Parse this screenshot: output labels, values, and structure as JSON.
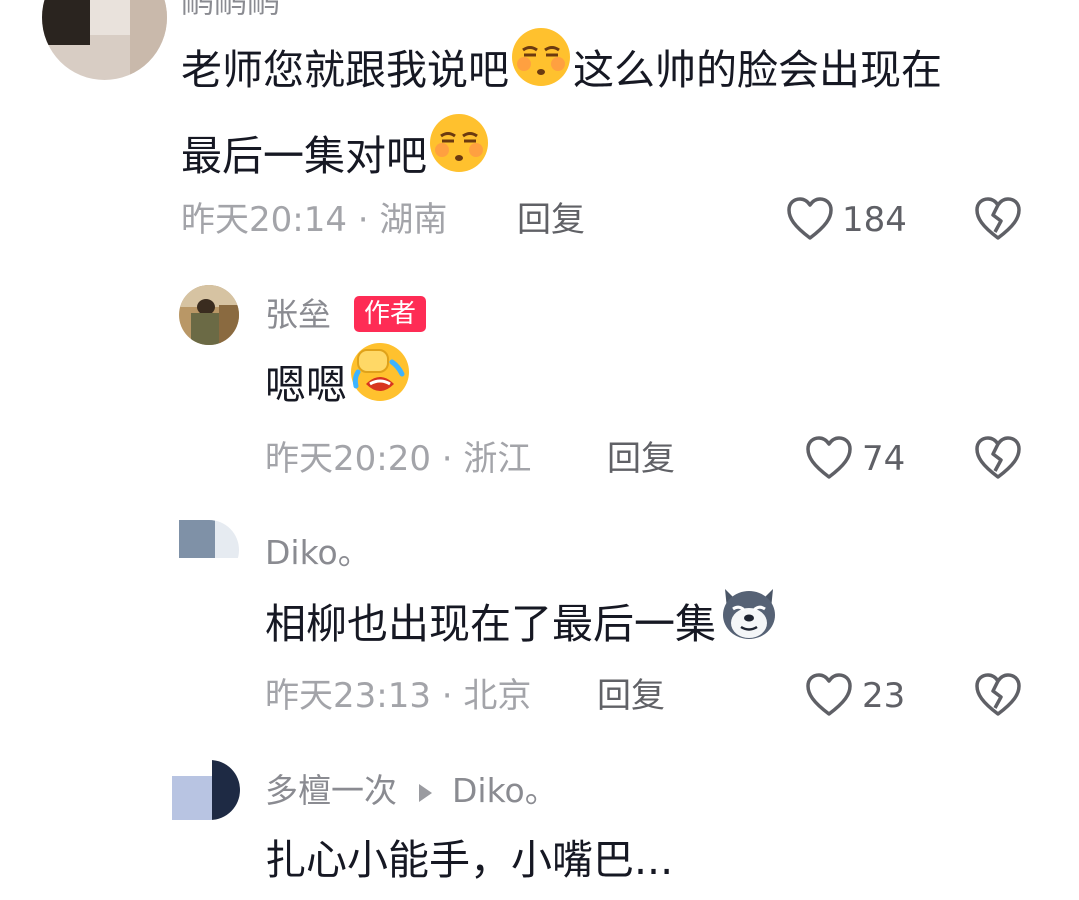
{
  "comments": [
    {
      "username": "鸸鸸鸸",
      "text_line1": "老师您就跟我说吧",
      "text_line1b": "这么帅的脸会出现在",
      "text_line2": "最后一集对吧",
      "time": "昨天20:14",
      "separator": "·",
      "location": "湖南",
      "reply_label": "回复",
      "likes": "184",
      "emoji": "smug-face-emoji"
    },
    {
      "username": "张垒",
      "badge": "作者",
      "text": "嗯嗯",
      "time": "昨天20:20",
      "separator": "·",
      "location": "浙江",
      "reply_label": "回复",
      "likes": "74",
      "emoji": "facepalm-laugh-emoji"
    },
    {
      "username": "Diko。",
      "text": "相柳也出现在了最后一集",
      "time": "昨天23:13",
      "separator": "·",
      "location": "北京",
      "reply_label": "回复",
      "likes": "23",
      "emoji": "husky-dog-emoji"
    },
    {
      "username": "多檀一次",
      "reply_to": "Diko。",
      "text": "扎心小能手，小嘴巴..."
    }
  ],
  "icons": {
    "like": "heart-outline-icon",
    "dislike": "broken-heart-icon",
    "reply_arrow": "triangle-right-icon"
  },
  "colors": {
    "author_badge": "#fe2c55",
    "meta_text": "#a3a4a9",
    "username": "#8a8b91",
    "body_text": "#161823"
  }
}
